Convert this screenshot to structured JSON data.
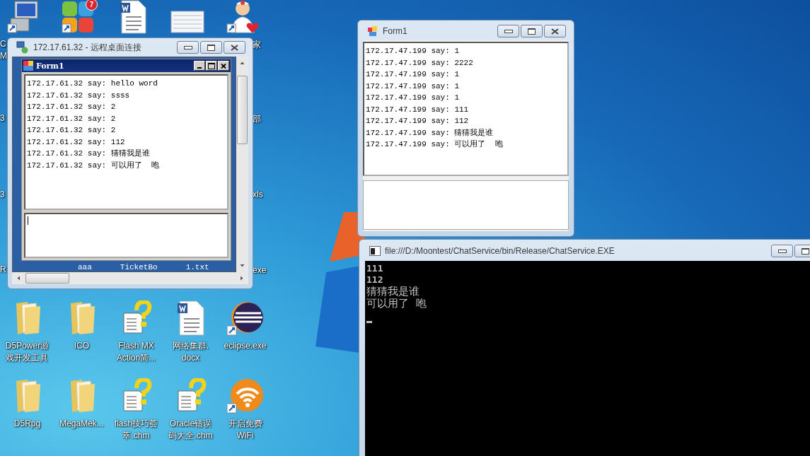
{
  "top_icons": [
    {
      "kind": "computer"
    },
    {
      "kind": "apps",
      "badge": "7"
    },
    {
      "kind": "word"
    },
    {
      "kind": "sheet"
    },
    {
      "kind": "doctor"
    }
  ],
  "left_edge_labels": [
    "C",
    "M",
    "3",
    "3",
    "R"
  ],
  "right_edge_labels": [
    "家",
    "部",
    "xls",
    "exe"
  ],
  "remote_window": {
    "title": "172.17.61.32 - 远程桌面连接",
    "form": {
      "title": "Form1",
      "messages": [
        "172.17.61.32 say: hello word",
        "172.17.61.32 say: ssss",
        "172.17.61.32 say: 2",
        "172.17.61.32 say: 2",
        "172.17.61.32 say: 2",
        "172.17.61.32 say: 112",
        "172.17.61.32 say: 猜猜我是谁",
        "172.17.61.32 say: 可以用了  咆"
      ]
    },
    "background_labels": [
      "aaa",
      "TicketBo",
      "1.txt"
    ]
  },
  "form_window": {
    "title": "Form1",
    "messages": [
      "172.17.47.199 say: 1",
      "172.17.47.199 say: 2222",
      "172.17.47.199 say: 1",
      "172.17.47.199 say: 1",
      "172.17.47.199 say: 1",
      "172.17.47.199 say: 111",
      "172.17.47.199 say: 112",
      "172.17.47.199 say: 猜猜我是谁",
      "172.17.47.199 say: 可以用了  咆"
    ]
  },
  "console": {
    "title": "file:///D:/Moontest/ChatService/bin/Release/ChatService.EXE",
    "lines": [
      {
        "kind": "ascii",
        "text": "111"
      },
      {
        "kind": "ascii",
        "text": "112"
      },
      {
        "kind": "cjk",
        "text": "猜猜我是谁"
      },
      {
        "kind": "cjk",
        "text": "可以用了  咆"
      }
    ]
  },
  "desktop_icons": [
    {
      "kind": "folder",
      "shortcut": false,
      "lines": [
        "D5Power游",
        "戏开发工具"
      ]
    },
    {
      "kind": "folder",
      "shortcut": false,
      "lines": [
        "ICO"
      ]
    },
    {
      "kind": "help",
      "shortcut": false,
      "lines": [
        "Flash MX",
        "Action简..."
      ]
    },
    {
      "kind": "word",
      "shortcut": false,
      "lines": [
        "网络集群.",
        "docx"
      ]
    },
    {
      "kind": "eclipse",
      "shortcut": true,
      "lines": [
        "eclipse.exe"
      ]
    },
    {
      "kind": "folder",
      "shortcut": false,
      "lines": [
        "D5Rpg"
      ]
    },
    {
      "kind": "folder",
      "shortcut": false,
      "lines": [
        "MegaMek..."
      ]
    },
    {
      "kind": "help",
      "shortcut": false,
      "lines": [
        "flash技巧荟",
        "萃.chm"
      ]
    },
    {
      "kind": "help",
      "shortcut": false,
      "lines": [
        "Oracle错误",
        "码大全.chm"
      ]
    },
    {
      "kind": "wifi",
      "shortcut": true,
      "lines": [
        "开启免费",
        "WiFi"
      ]
    }
  ]
}
